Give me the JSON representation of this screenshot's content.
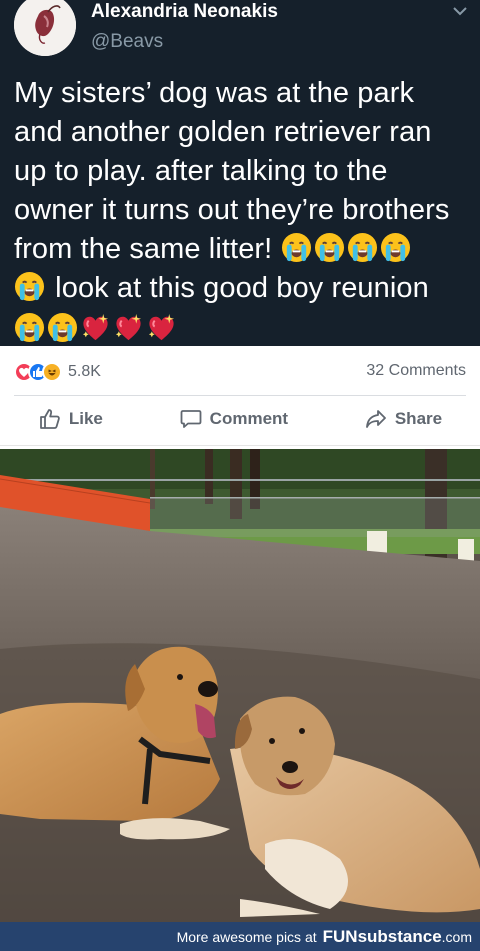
{
  "tweet": {
    "display_name": "Alexandria Neonakis",
    "handle": "@Beavs",
    "text_lines": [
      "My sisters’ dog was at the park",
      "and another golden retriever ran",
      "up to play. after talking to the",
      "owner it turns out they’re brothers",
      "from the same litter!",
      "look at this good boy reunion"
    ],
    "emoji_line1": [
      "crying-face",
      "crying-face",
      "crying-face",
      "crying-face"
    ],
    "emoji_line2": [
      "crying-face"
    ],
    "emoji_line3": [
      "crying-face",
      "crying-face",
      "sparkling-heart",
      "sparkling-heart",
      "sparkling-heart"
    ]
  },
  "facebook": {
    "reaction_icons": [
      "love-icon",
      "like-icon",
      "haha-icon"
    ],
    "reaction_count": "5.8K",
    "comments": "32 Comments",
    "like_label": "Like",
    "comment_label": "Comment",
    "share_label": "Share",
    "colors": {
      "like_blue": "#1877f2",
      "love_red": "#f33e58",
      "haha_yellow": "#f7b125",
      "text_gray": "#606770"
    }
  },
  "photo": {
    "subject": "two golden retrievers lying together in a dirt dog park"
  },
  "footer": {
    "prefix": "More awesome pics at",
    "brand": "FUNsubstance",
    "tld": ".com",
    "bg_color": "#26436e"
  },
  "colors": {
    "tweet_bg": "#15202b",
    "handle_gray": "#8899a6"
  }
}
